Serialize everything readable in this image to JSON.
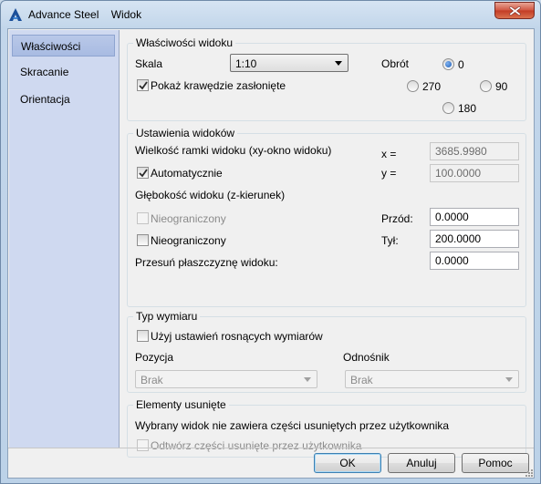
{
  "window": {
    "app_name": "Advance Steel",
    "title": "Widok",
    "icons": {
      "logo": "advance-steel-logo-icon",
      "close": "close-icon"
    }
  },
  "sidebar": {
    "items": [
      {
        "label": "Właściwości",
        "selected": true
      },
      {
        "label": "Skracanie",
        "selected": false
      },
      {
        "label": "Orientacja",
        "selected": false
      }
    ]
  },
  "view_properties": {
    "title": "Właściwości widoku",
    "scale_label": "Skala",
    "scale_value": "1:10",
    "rotation_label": "Obrót",
    "rotation_options": [
      "0",
      "270",
      "90",
      "180"
    ],
    "rotation_selected": "0",
    "show_hidden_edges_label": "Pokaż krawędzie zasłonięte",
    "show_hidden_edges_checked": true
  },
  "view_settings": {
    "title": "Ustawienia widoków",
    "frame_size_label": "Wielkość ramki widoku (xy-okno widoku)",
    "x_label": "x =",
    "x_value": "3685.9980",
    "y_label": "y =",
    "y_value": "100.0000",
    "automatic_label": "Automatycznie",
    "automatic_checked": true,
    "depth_label": "Głębokość widoku (z-kierunek)",
    "unlimited_front_label": "Nieograniczony",
    "unlimited_front_checked": false,
    "unlimited_back_label": "Nieograniczony",
    "unlimited_back_checked": false,
    "front_label": "Przód:",
    "front_value": "0.0000",
    "back_label": "Tył:",
    "back_value": "200.0000",
    "shift_plane_label": "Przesuń płaszczyznę widoku:",
    "shift_plane_value": "0.0000"
  },
  "dimension_type": {
    "title": "Typ wymiaru",
    "use_incremental_label": "Użyj ustawień rosnących wymiarów",
    "use_incremental_checked": false,
    "position_label": "Pozycja",
    "position_value": "Brak",
    "reference_label": "Odnośnik",
    "reference_value": "Brak"
  },
  "removed_elements": {
    "title": "Elementy usunięte",
    "message": "Wybrany widok nie zawiera części usuniętych przez użytkownika",
    "restore_label": "Odtwórz części usunięte przez użytkownika",
    "restore_checked": false
  },
  "buttons": {
    "ok": "OK",
    "cancel": "Anuluj",
    "help": "Pomoc"
  },
  "colors": {
    "accent_blue": "#1f5fb8",
    "sidebar_bg": "#cfd9f0",
    "close_red": "#c23b25"
  }
}
